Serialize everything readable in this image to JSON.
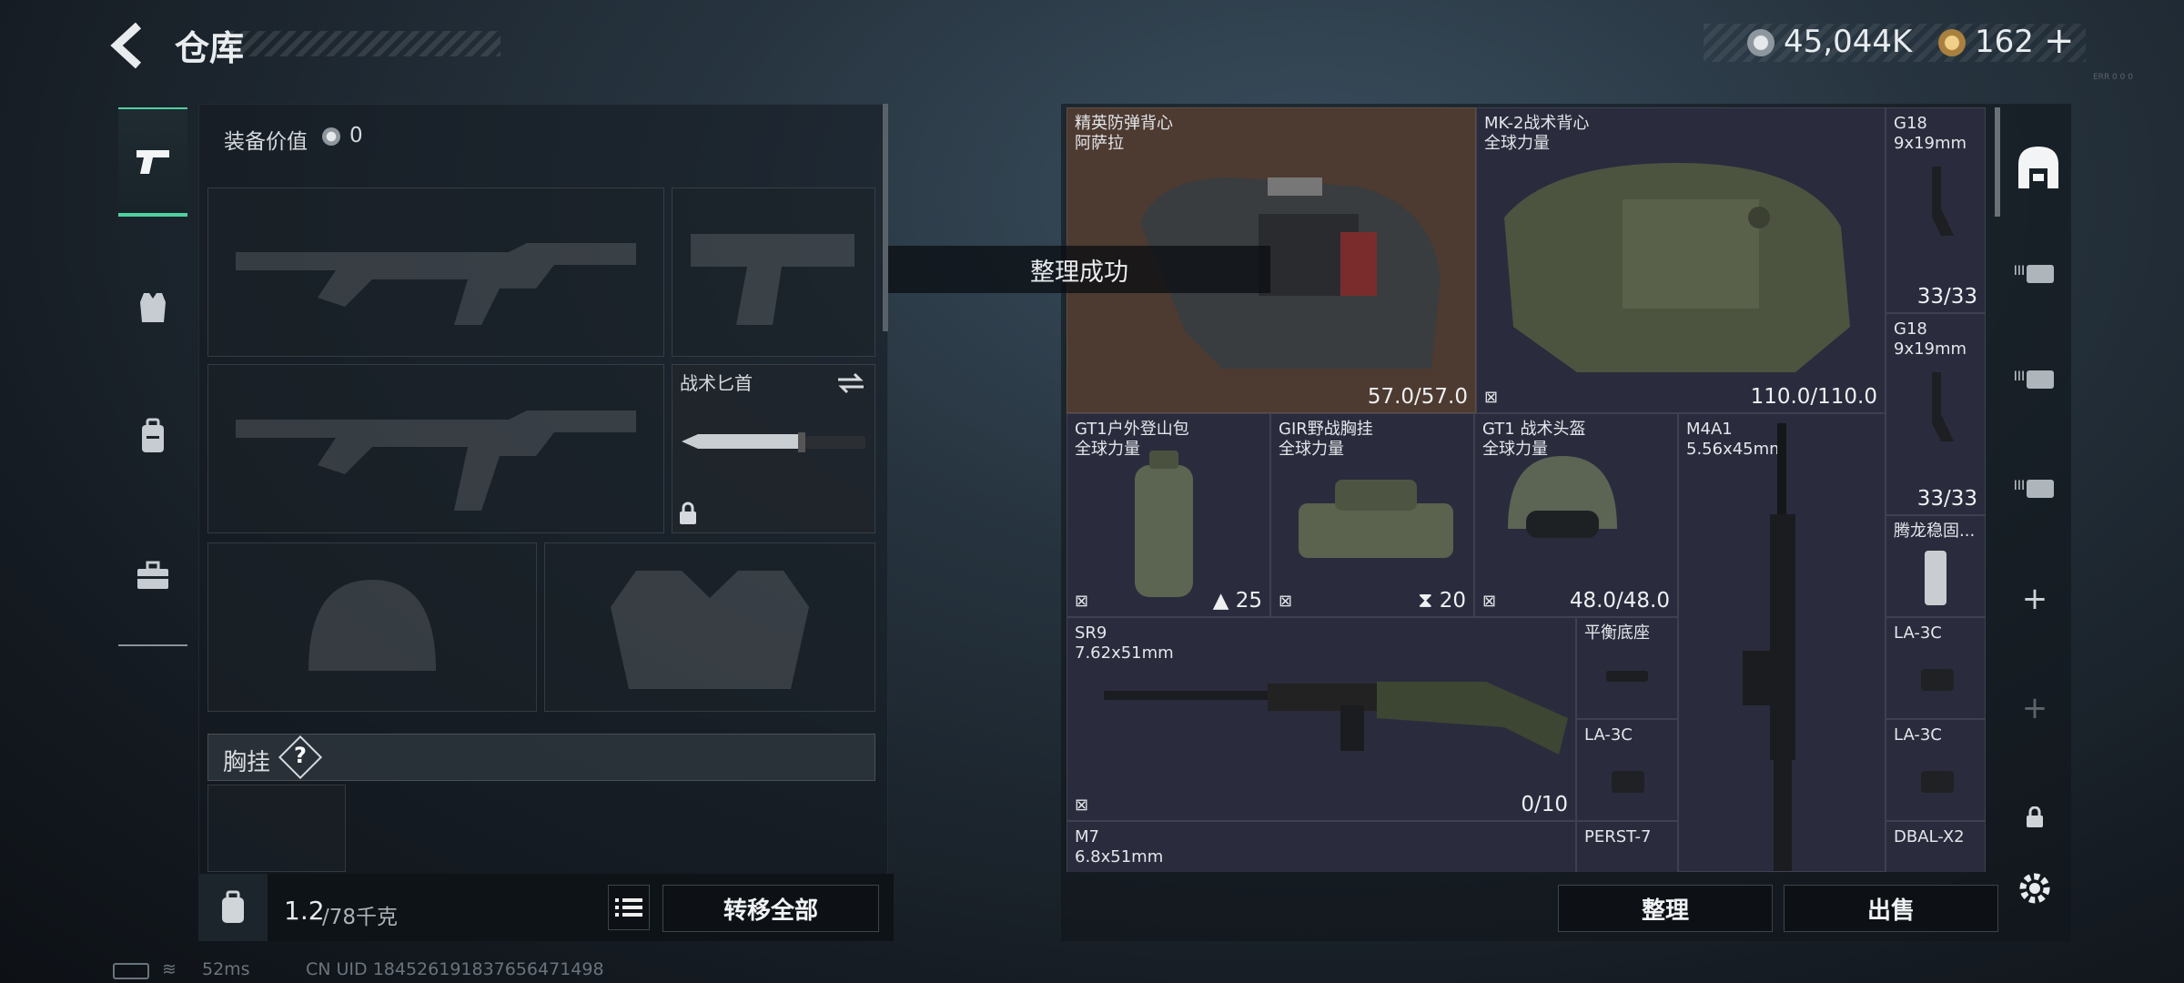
{
  "header": {
    "title": "仓库",
    "currency_main": "45,044K",
    "currency_secondary": "162",
    "add_label": "+",
    "top_tiny": "ERR 0 0 0"
  },
  "left_tabs": [
    {
      "name": "weapons"
    },
    {
      "name": "armor"
    },
    {
      "name": "backpack"
    },
    {
      "name": "toolbox"
    }
  ],
  "loadout": {
    "equipment_value_label": "装备价值",
    "equipment_value": "0",
    "knife_label": "战术匕首",
    "chest_rig_label": "胸挂",
    "chest_rig_help": "?",
    "weight_current": "1.2",
    "weight_max": "/78千克",
    "transfer_all_label": "转移全部"
  },
  "toast": "整理成功",
  "storage": {
    "items": [
      {
        "id": "vest-elite",
        "name": "精英防弹背心",
        "sub": "阿萨拉",
        "value": "57.0/57.0"
      },
      {
        "id": "vest-mk2",
        "name": "MK-2战术背心",
        "sub": "全球力量",
        "value": "110.0/110.0"
      },
      {
        "id": "g18-a",
        "name": "G18",
        "sub": "9x19mm",
        "value": "33/33"
      },
      {
        "id": "g18-b",
        "name": "G18",
        "sub": "9x19mm",
        "value": "33/33"
      },
      {
        "id": "backpack",
        "name": "GT1户外登山包",
        "sub": "全球力量",
        "value": "25"
      },
      {
        "id": "rig",
        "name": "GIR野战胸挂",
        "sub": "全球力量",
        "value": "20"
      },
      {
        "id": "helmet",
        "name": "GT1 战术头盔",
        "sub": "全球力量",
        "value": "48.0/48.0"
      },
      {
        "id": "m4a1",
        "name": "M4A1",
        "sub": "5.56x45mm"
      },
      {
        "id": "grip",
        "name": "腾龙稳固...",
        "sub": ""
      },
      {
        "id": "sr9",
        "name": "SR9",
        "sub": "7.62x51mm",
        "value": "0/10"
      },
      {
        "id": "base",
        "name": "平衡底座",
        "sub": ""
      },
      {
        "id": "la3c-a",
        "name": "LA-3C",
        "sub": ""
      },
      {
        "id": "la3c-b",
        "name": "LA-3C",
        "sub": ""
      },
      {
        "id": "la3c-c",
        "name": "LA-3C",
        "sub": ""
      },
      {
        "id": "m7",
        "name": "M7",
        "sub": "6.8x51mm"
      },
      {
        "id": "perst7",
        "name": "PERST-7",
        "sub": ""
      },
      {
        "id": "dbal",
        "name": "DBAL-X2",
        "sub": ""
      }
    ],
    "sort_label": "整理",
    "sell_label": "出售"
  },
  "right_tabs": [
    {
      "label": "III"
    },
    {
      "label": "III"
    },
    {
      "label": "III"
    }
  ],
  "status": {
    "ping": "52ms",
    "uid": "CN UID 184526191837656471498"
  },
  "colors": {
    "accent": "#4fd1a0",
    "highlight_cell": "#4d3a31",
    "cell": "#2a2c3d"
  }
}
